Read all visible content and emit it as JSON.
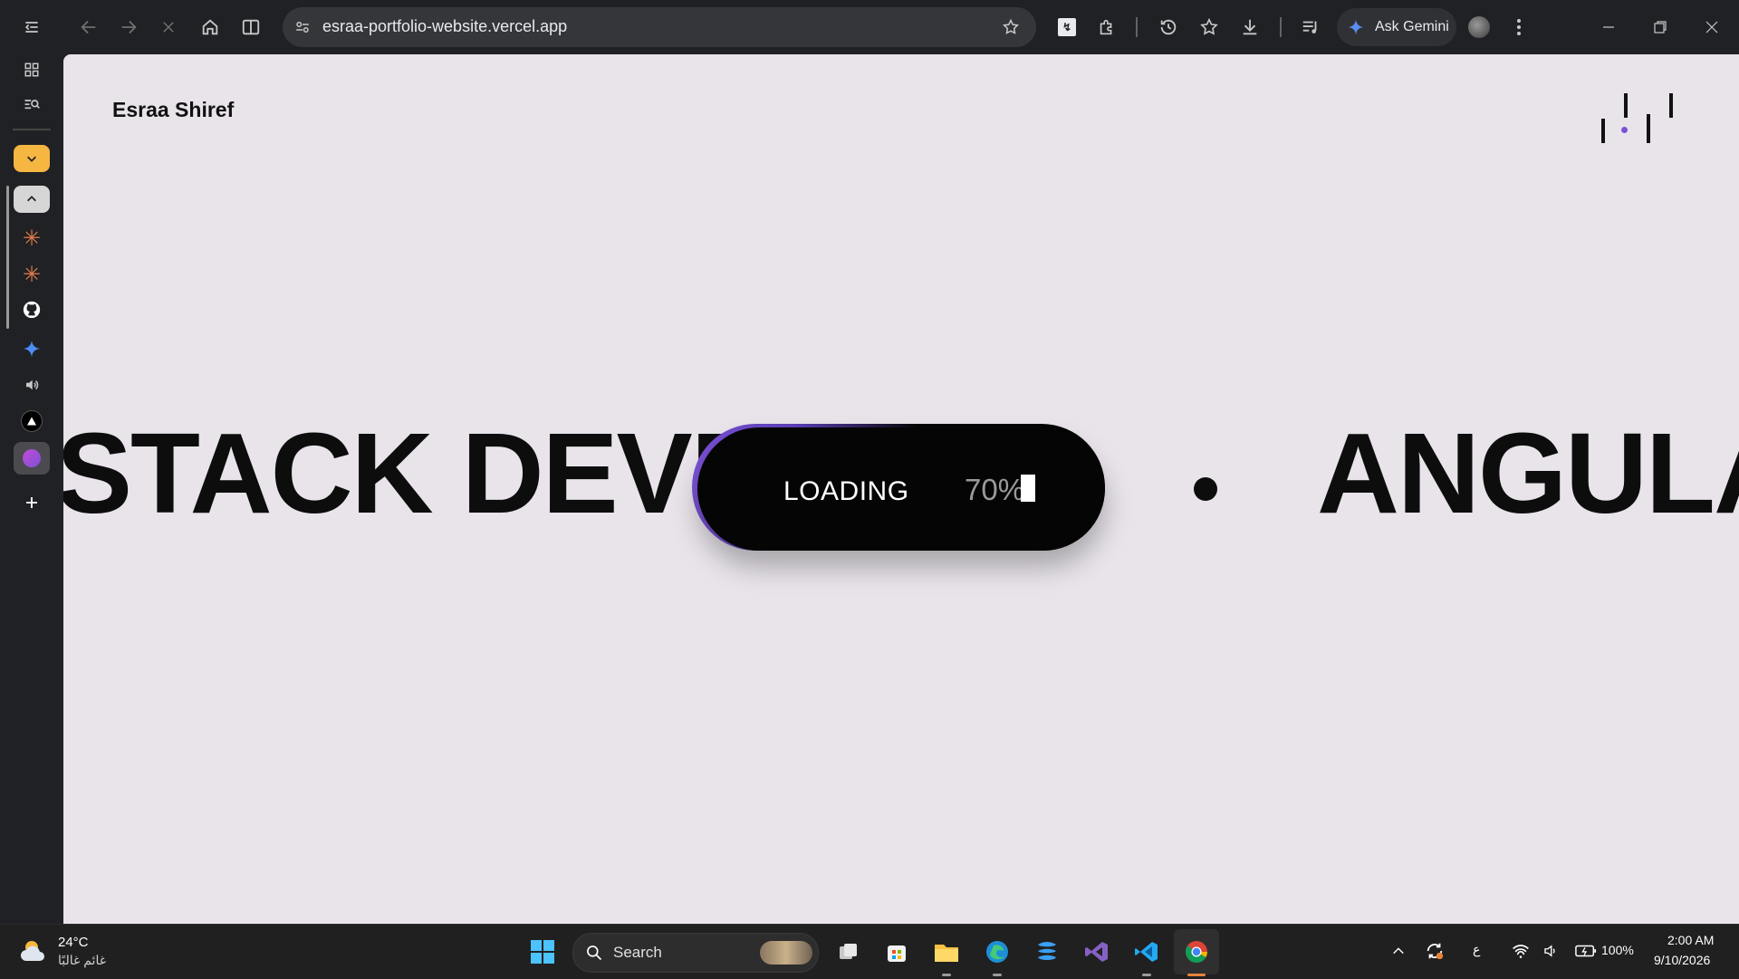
{
  "browser": {
    "url": "esraa-portfolio-website.vercel.app",
    "ask_gemini_label": "Ask Gemini"
  },
  "page": {
    "brand": "Esraa Shiref",
    "marquee_left": "STACK DEVE",
    "marquee_right": "ANGULA",
    "loading_label": "LOADING",
    "loading_percent": "70%",
    "loading_value": 70
  },
  "taskbar": {
    "temperature": "24°C",
    "weather_status": "غائم غالبًا",
    "search_placeholder": "Search",
    "ime_indicator": "ع",
    "battery": "100%",
    "time": "2:00 AM",
    "date": "9/10/2026"
  },
  "colors": {
    "accent": "#7b52d6",
    "page_bg": "#e8e4ea",
    "chrome_bg": "#202124"
  }
}
